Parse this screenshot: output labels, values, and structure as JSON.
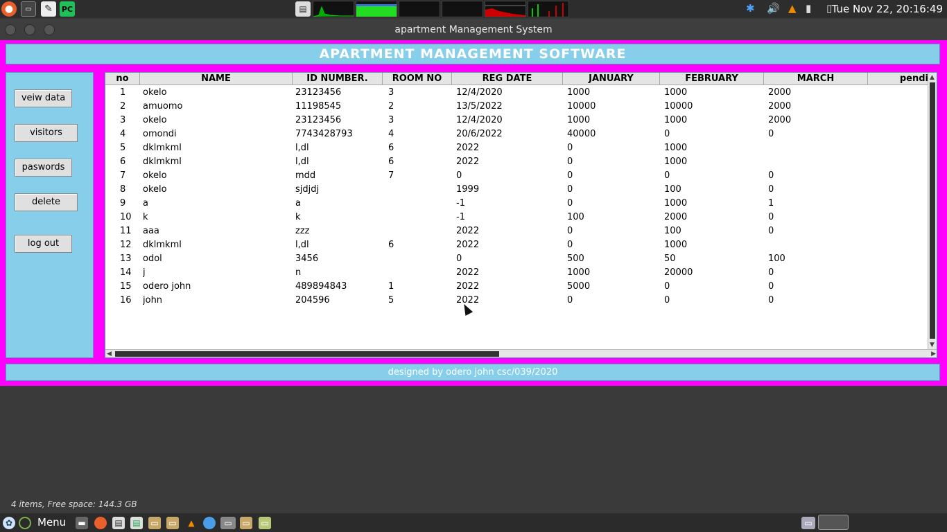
{
  "topbar": {
    "clock": "Tue Nov 22, 20:16:49",
    "launchers": [
      "firefox-icon",
      "terminal-icon",
      "text-editor-icon",
      "pycharm-icon"
    ]
  },
  "window": {
    "title": "apartment Management System"
  },
  "app": {
    "header": "APARTMENT MANAGEMENT SOFTWARE",
    "footer": "designed by odero john csc/039/2020",
    "sidebar": {
      "view_data": "veiw data",
      "visitors": "visitors",
      "passwords": "paswords",
      "delete": "delete",
      "logout": "log out"
    },
    "table": {
      "columns": [
        "no",
        "NAME",
        "ID NUMBER.",
        "ROOM NO",
        "REG DATE",
        "JANUARY",
        "FEBRUARY",
        "MARCH",
        "pendi"
      ],
      "rows": [
        [
          "1",
          "okelo",
          "23123456",
          "3",
          "12/4/2020",
          "1000",
          "1000",
          "2000"
        ],
        [
          "2",
          "amuomo",
          "11198545",
          "2",
          "13/5/2022",
          "10000",
          "10000",
          "2000"
        ],
        [
          "3",
          "okelo",
          "23123456",
          "3",
          "12/4/2020",
          "1000",
          "1000",
          "2000"
        ],
        [
          "4",
          "omondi",
          "7743428793",
          "4",
          "20/6/2022",
          "40000",
          "0",
          "0"
        ],
        [
          "5",
          "dklmkml",
          "l,dl",
          "6",
          "2022",
          "0",
          "1000",
          ""
        ],
        [
          "6",
          "dklmkml",
          "l,dl",
          "6",
          "2022",
          "0",
          "1000",
          ""
        ],
        [
          "7",
          "okelo",
          "mdd",
          "7",
          "0",
          "0",
          "0",
          "0"
        ],
        [
          "8",
          "okelo",
          "sjdjdj",
          "",
          "1999",
          "0",
          "100",
          "0"
        ],
        [
          "9",
          "a",
          "a",
          "",
          "-1",
          "0",
          "1000",
          "1"
        ],
        [
          "10",
          "k",
          "k",
          "",
          "-1",
          "100",
          "2000",
          "0"
        ],
        [
          "11",
          "aaa",
          "zzz",
          "",
          "2022",
          "0",
          "100",
          "0"
        ],
        [
          "12",
          "dklmkml",
          "l,dl",
          "6",
          "2022",
          "0",
          "1000",
          ""
        ],
        [
          "13",
          "odol",
          "3456",
          "",
          "0",
          "500",
          "50",
          "100"
        ],
        [
          "14",
          "j",
          "n",
          "",
          "2022",
          "1000",
          "20000",
          "0"
        ],
        [
          "15",
          "odero john",
          "489894843",
          "1",
          "2022",
          "5000",
          "0",
          "0"
        ],
        [
          "16",
          "john",
          "204596",
          "5",
          "2022",
          "0",
          "0",
          "0"
        ]
      ]
    }
  },
  "statusbar": {
    "text": "4 items, Free space: 144.3 GB"
  },
  "taskbar": {
    "menu_label": "Menu"
  }
}
